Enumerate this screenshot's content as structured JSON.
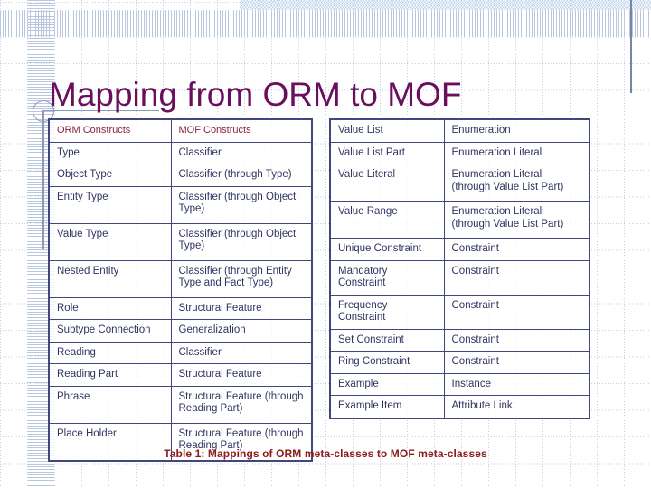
{
  "title": "Mapping from ORM to MOF",
  "caption": "Table 1: Mappings of ORM meta-classes to MOF meta-classes",
  "colors": {
    "title": "#6a0f5e",
    "table_border": "#41477c",
    "body_text": "#2f3560",
    "header_text": "#8c2040",
    "caption_text": "#8c1a1a",
    "grid_line": "#c3cfe6",
    "band": "#b9cce8"
  },
  "left_table": {
    "headers": [
      "ORM Constructs",
      "MOF Constructs"
    ],
    "rows": [
      [
        "Type",
        "Classifier"
      ],
      [
        "Object Type",
        "Classifier (through Type)"
      ],
      [
        "Entity Type",
        "Classifier (through Object Type)"
      ],
      [
        "Value Type",
        "Classifier (through Object Type)"
      ],
      [
        "Nested Entity",
        "Classifier (through Entity Type and Fact Type)"
      ],
      [
        "Role",
        "Structural Feature"
      ],
      [
        "Subtype Connection",
        "Generalization"
      ],
      [
        "Reading",
        "Classifier"
      ],
      [
        "Reading Part",
        "Structural Feature"
      ],
      [
        "Phrase",
        "Structural Feature (through Reading Part)"
      ],
      [
        "Place Holder",
        "Structural Feature (through Reading Part)"
      ]
    ]
  },
  "right_table": {
    "rows": [
      [
        "Value List",
        "Enumeration"
      ],
      [
        "Value List Part",
        "Enumeration Literal"
      ],
      [
        "Value Literal",
        "Enumeration Literal (through Value List Part)"
      ],
      [
        "Value Range",
        "Enumeration Literal (through Value List Part)"
      ],
      [
        "Unique Constraint",
        "Constraint"
      ],
      [
        "Mandatory Constraint",
        "Constraint"
      ],
      [
        "Frequency Constraint",
        "Constraint"
      ],
      [
        "Set Constraint",
        "Constraint"
      ],
      [
        "Ring Constraint",
        "Constraint"
      ],
      [
        "Example",
        "Instance"
      ],
      [
        "Example Item",
        "Attribute Link"
      ]
    ]
  }
}
